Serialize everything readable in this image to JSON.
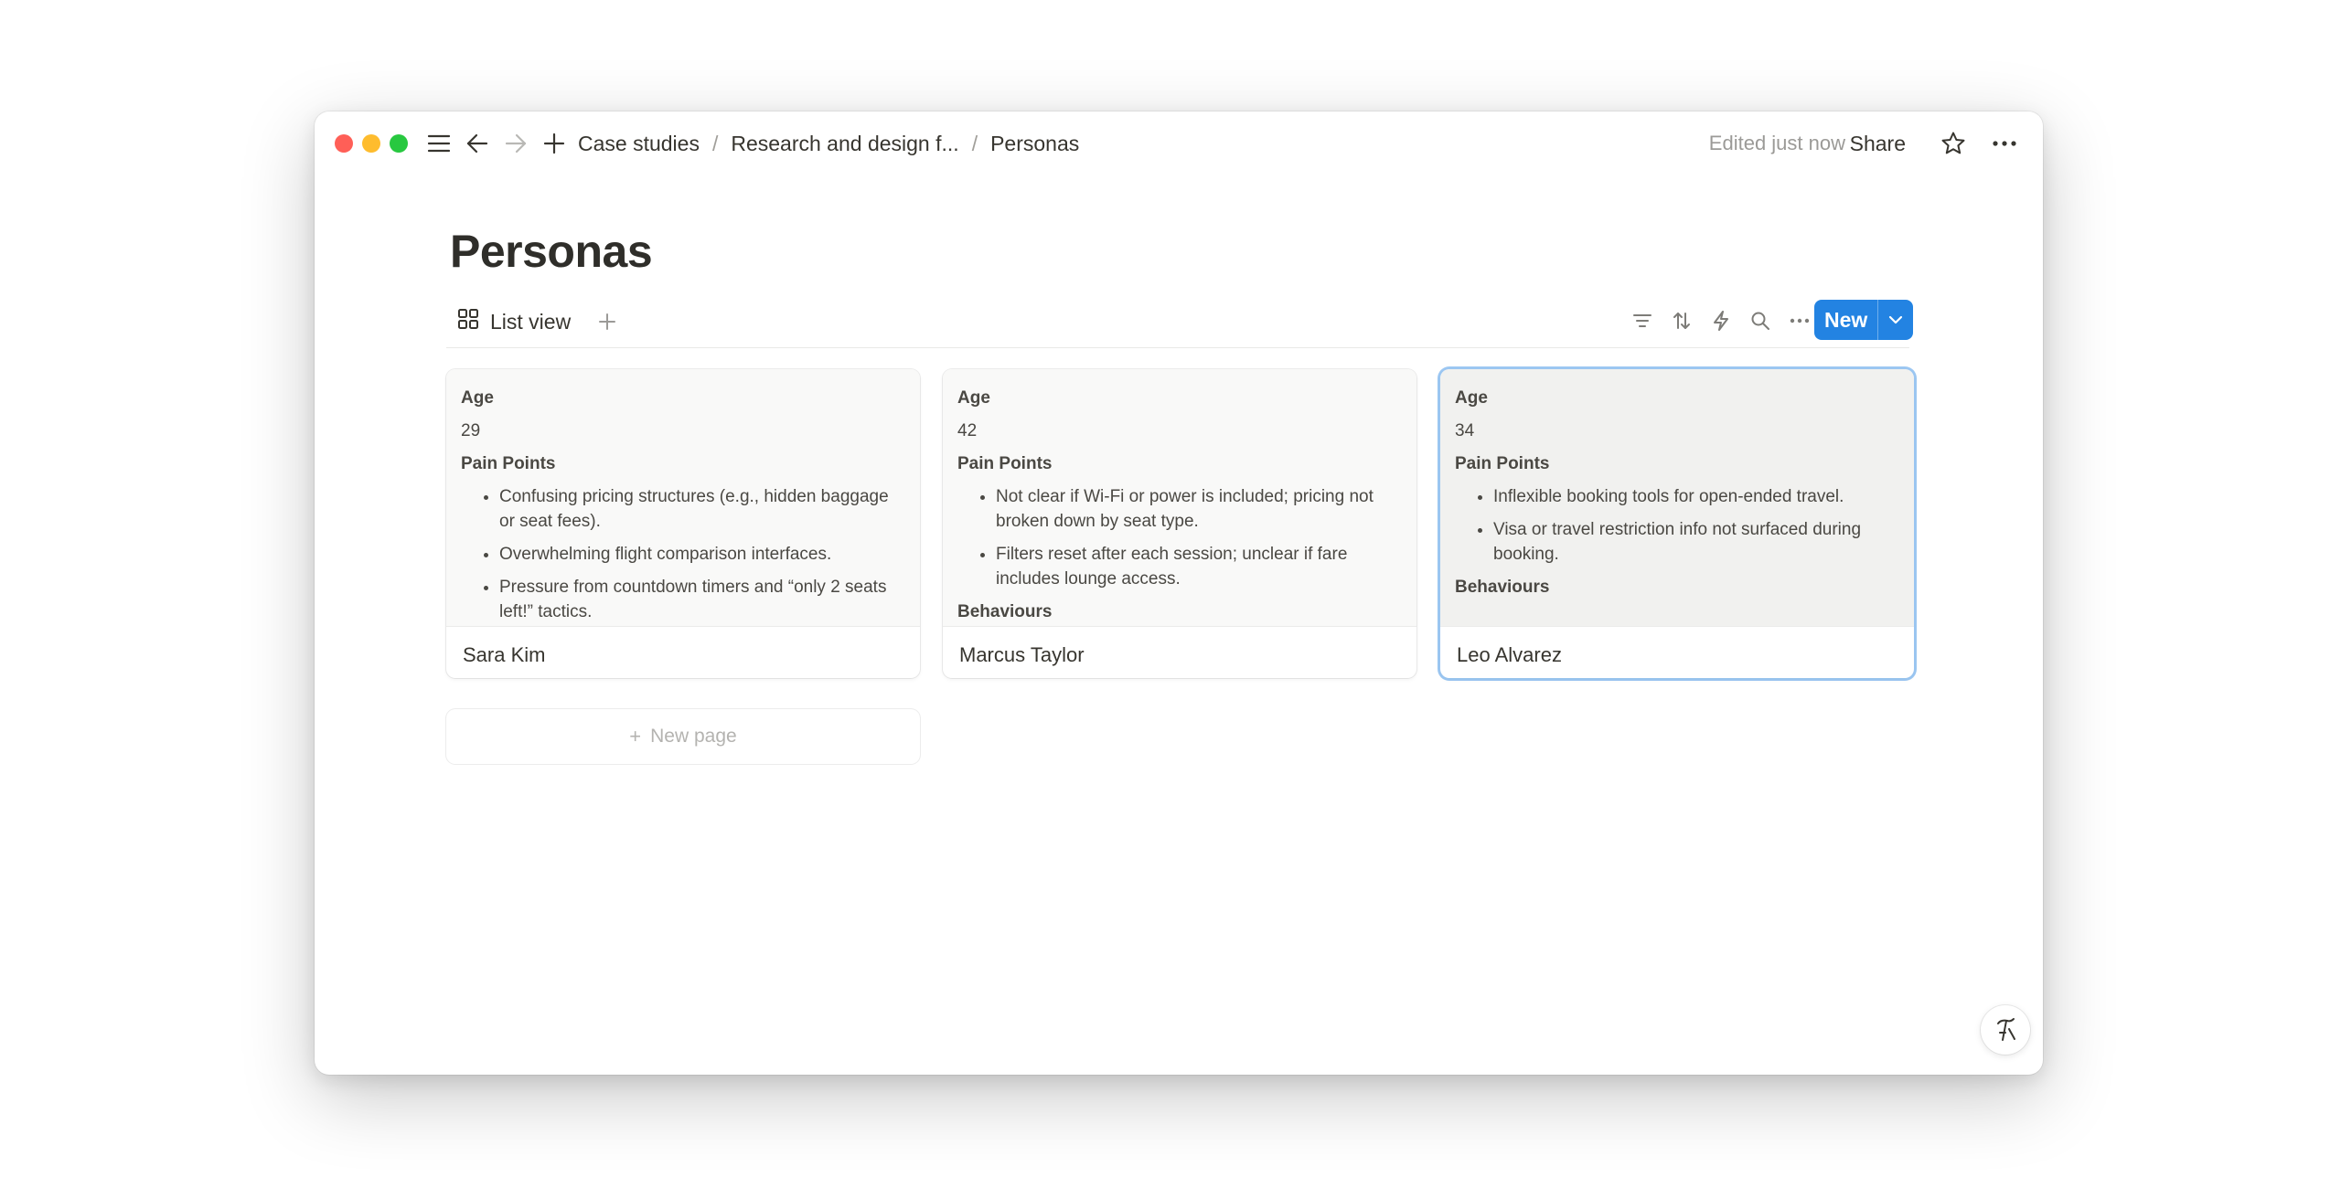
{
  "topbar": {
    "breadcrumbs": [
      "Case studies",
      "Research and design f...",
      "Personas"
    ],
    "edited": "Edited just now",
    "share": "Share"
  },
  "page": {
    "title": "Personas"
  },
  "view": {
    "label": "List view",
    "new_button": "New"
  },
  "cards": [
    {
      "age_label": "Age",
      "age": "29",
      "pain_label": "Pain Points",
      "pain_points": [
        "Confusing pricing structures (e.g., hidden baggage or seat fees).",
        "Overwhelming flight comparison interfaces.",
        "Pressure from countdown timers and “only 2 seats left!” tactics."
      ],
      "behaviours_label": "",
      "name": "Sara Kim"
    },
    {
      "age_label": "Age",
      "age": "42",
      "pain_label": "Pain Points",
      "pain_points": [
        "Not clear if Wi-Fi or power is included; pricing not broken down by seat type.",
        "Filters reset after each session; unclear if fare includes lounge access."
      ],
      "behaviours_label": "Behaviours",
      "name": "Marcus Taylor"
    },
    {
      "age_label": "Age",
      "age": "34",
      "pain_label": "Pain Points",
      "pain_points": [
        "Inflexible booking tools for open-ended travel.",
        "Visa or travel restriction info not surfaced during booking."
      ],
      "behaviours_label": "Behaviours",
      "name": "Leo Alvarez"
    }
  ],
  "new_page": "New page",
  "icons": {
    "menu": "hamburger-icon",
    "back": "arrow-left-icon",
    "forward": "arrow-right-icon",
    "add": "plus-icon",
    "star": "star-icon",
    "more": "ellipsis-icon",
    "grid": "grid-icon",
    "filter": "filter-icon",
    "sort": "sort-icon",
    "automation": "lightning-icon",
    "search": "search-icon",
    "help": "help-icon"
  },
  "colors": {
    "accent": "#2383e2",
    "selected_outline": "#93c0f0"
  }
}
